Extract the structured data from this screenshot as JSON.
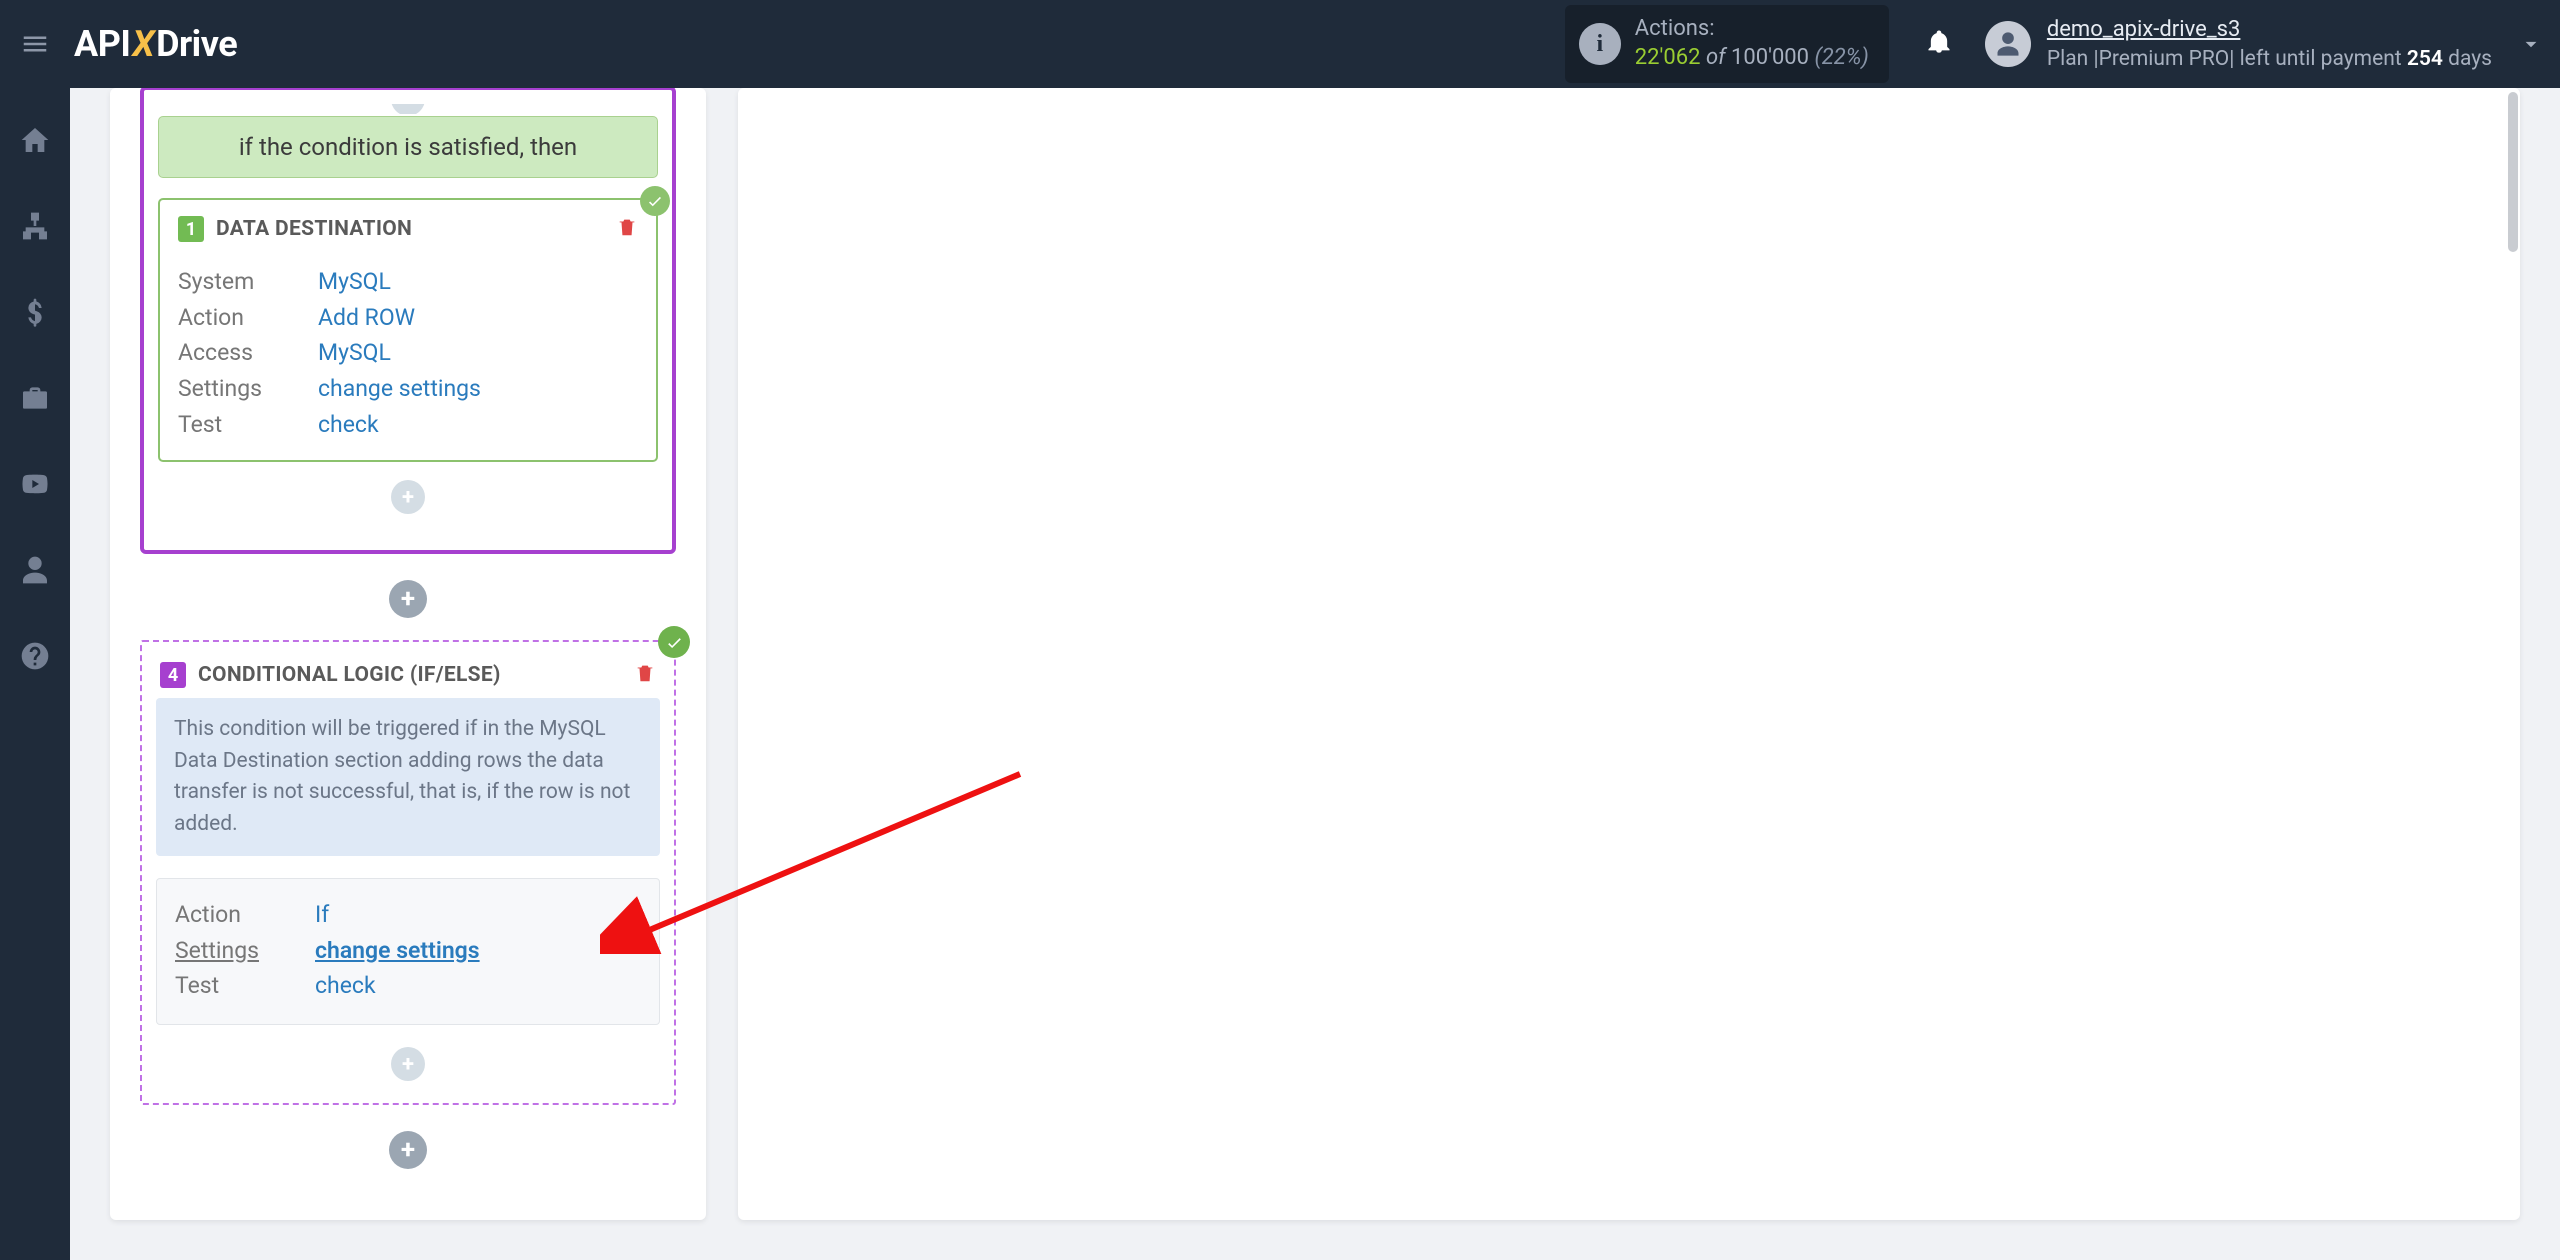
{
  "topbar": {
    "logo": {
      "api": "API",
      "x": "X",
      "drive": "Drive"
    },
    "actions": {
      "label": "Actions:",
      "used": "22'062",
      "of": "of",
      "total": "100'000",
      "pct": "(22%)"
    },
    "user": {
      "name": "demo_apix-drive_s3",
      "plan_prefix": "Plan |Premium PRO| left until payment ",
      "days": "254",
      "plan_suffix": " days"
    }
  },
  "leftrail": {
    "items": [
      "home",
      "sitemap",
      "dollar",
      "briefcase",
      "youtube",
      "user",
      "help"
    ]
  },
  "left_panel": {
    "plus_top_partial": true,
    "cond_banner": "if the condition is satisfied, then",
    "dest_card": {
      "badge": "1",
      "title": "DATA DESTINATION",
      "rows": [
        {
          "k": "System",
          "v": "MySQL"
        },
        {
          "k": "Action",
          "v": "Add ROW"
        },
        {
          "k": "Access",
          "v": "MySQL"
        },
        {
          "k": "Settings",
          "v": "change settings"
        },
        {
          "k": "Test",
          "v": "check"
        }
      ]
    },
    "logic_card": {
      "badge": "4",
      "title": "CONDITIONAL LOGIC (IF/ELSE)",
      "note": "This condition will be triggered if in the MySQL Data Destination section adding rows the data transfer is not successful, that is, if the row is not added.",
      "rows": [
        {
          "k": "Action",
          "v": "If"
        },
        {
          "k": "Settings",
          "v": "change settings",
          "highlight": true
        },
        {
          "k": "Test",
          "v": "check"
        }
      ]
    }
  }
}
